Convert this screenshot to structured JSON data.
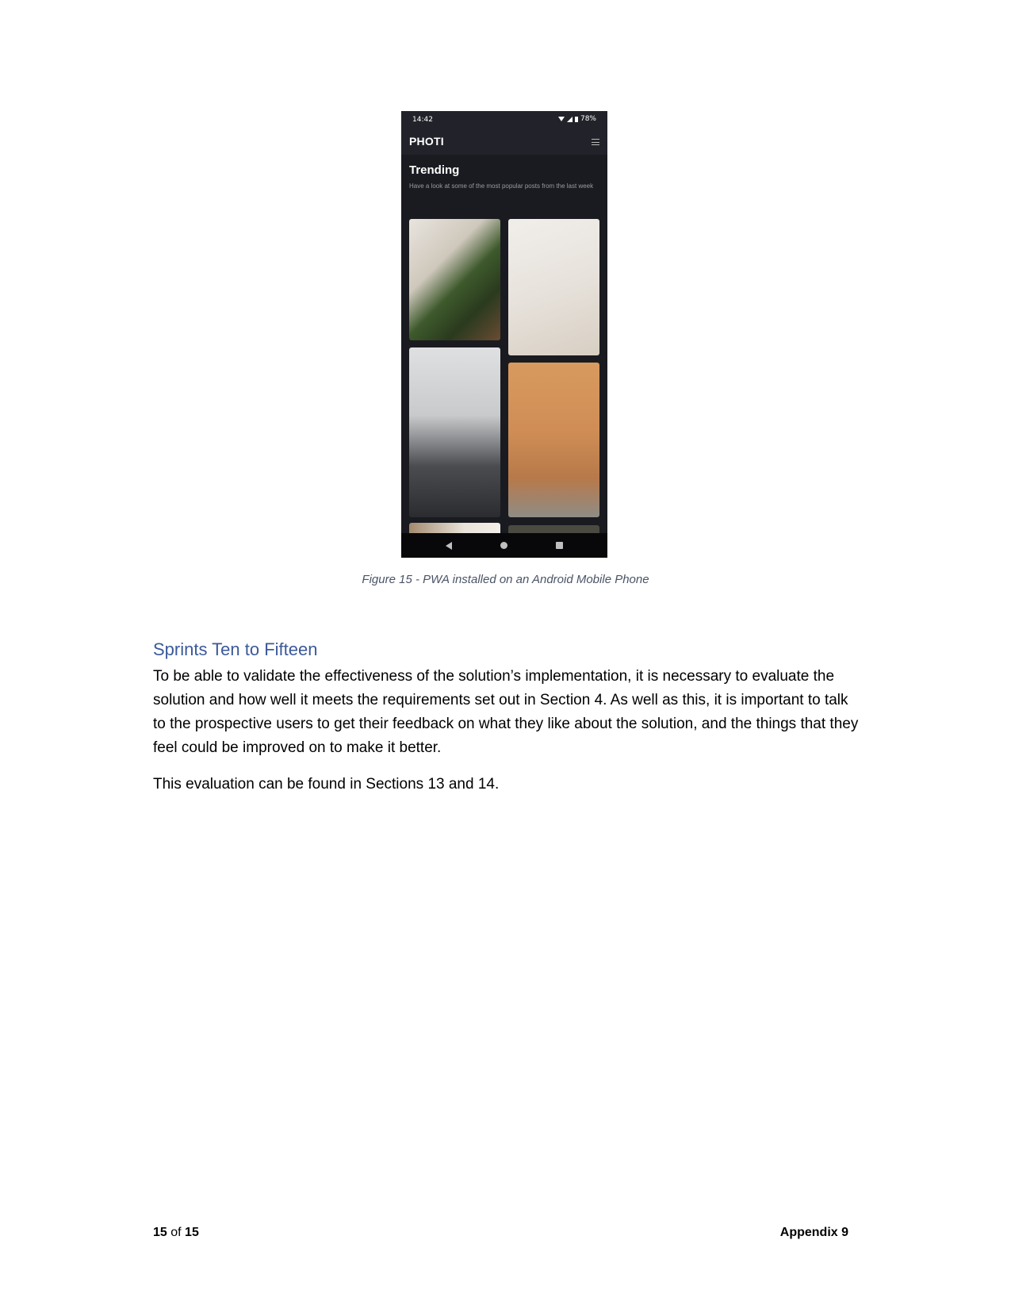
{
  "phone": {
    "status_time": "14:42",
    "battery": "78%",
    "app_name": "PHOTI",
    "trending_title": "Trending",
    "trending_subtitle": "Have a look at some of the most popular posts from the last week",
    "icons": [
      "wifi-icon",
      "signal-icon",
      "battery-icon",
      "menu-icon",
      "nav-back-icon",
      "nav-home-icon",
      "nav-recent-icon"
    ]
  },
  "caption": "Figure 15 - PWA installed on an Android Mobile Phone",
  "section": {
    "heading": "Sprints Ten to Fifteen",
    "paragraph1": "To be able to validate the effectiveness of the solution’s implementation, it is necessary to evaluate the solution and how well it meets the requirements set out in Section 4. As well as this, it is important to talk to the prospective users to get their feedback on what they like about the solution, and the things that they feel could be improved on to make it better.",
    "paragraph2": "This evaluation can be found in Sections 13 and 14."
  },
  "footer": {
    "page_current": "15",
    "page_of": "of",
    "page_total": "15",
    "appendix": "Appendix 9"
  }
}
